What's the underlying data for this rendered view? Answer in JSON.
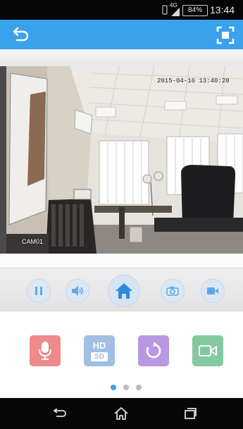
{
  "status_bar": {
    "network": "4G",
    "battery": "84%",
    "time": "13:44"
  },
  "app_bar": {
    "back_icon": "back-arrow-icon",
    "fullscreen_icon": "fullscreen-icon"
  },
  "video": {
    "timestamp": "2015-04-16 13:40:20",
    "camera_name": "CAM01"
  },
  "controls": {
    "pause_icon": "pause-icon",
    "audio_icon": "speaker-icon",
    "home_icon": "home-icon",
    "snapshot_icon": "camera-icon",
    "record_icon": "video-record-icon"
  },
  "quick_actions": {
    "mic_icon": "microphone-icon",
    "quality_top": "HD",
    "quality_bottom": "SD",
    "rotate_icon": "rotate-icon",
    "record_icon": "video-camera-icon",
    "colors": {
      "mic": "#ee8a8a",
      "quality": "#9fc0e2",
      "rotate": "#b898e2",
      "record": "#84c8a0"
    }
  },
  "pager": {
    "pages": 3,
    "active": 0,
    "active_color": "#3aa2ec",
    "inactive_color": "#bbbbbb"
  },
  "nav_bar": {
    "back": "nav-back-icon",
    "home": "nav-home-icon",
    "recents": "nav-recents-icon"
  }
}
